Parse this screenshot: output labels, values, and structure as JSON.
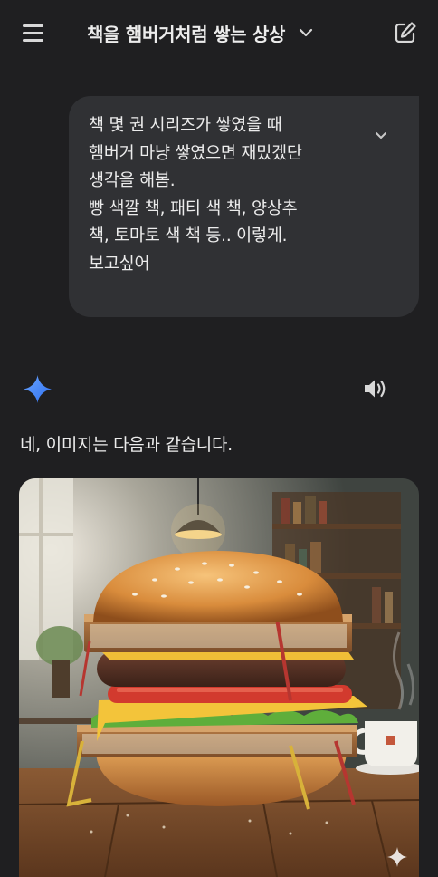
{
  "header": {
    "title": "책을 햄버거처럼 쌓는 상상",
    "menu_icon": "hamburger-menu-icon",
    "dropdown_icon": "chevron-down-icon",
    "edit_icon": "edit-square-icon"
  },
  "user_message": {
    "text": "책 몇 권 시리즈가 쌓였을 때\n햄버거 마냥 쌓였으면 재밌겠단\n생각을 해봄.\n빵 색깔 책, 패티 색 책, 양상추\n책, 토마토 색 책 등..  이렇게.\n보고싶어",
    "expand_icon": "chevron-down-icon"
  },
  "response": {
    "assistant_icon": "gemini-sparkle-icon",
    "speaker_icon": "speaker-icon",
    "text": "네, 이미지는 다음과 같습니다."
  },
  "image": {
    "subject": "burger-made-of-books",
    "watermark_icon": "sparkle-watermark-icon"
  },
  "colors": {
    "background": "#1f1f21",
    "bubble": "#303134",
    "text": "#ececec",
    "accent_blue": "#4b8ef5"
  }
}
